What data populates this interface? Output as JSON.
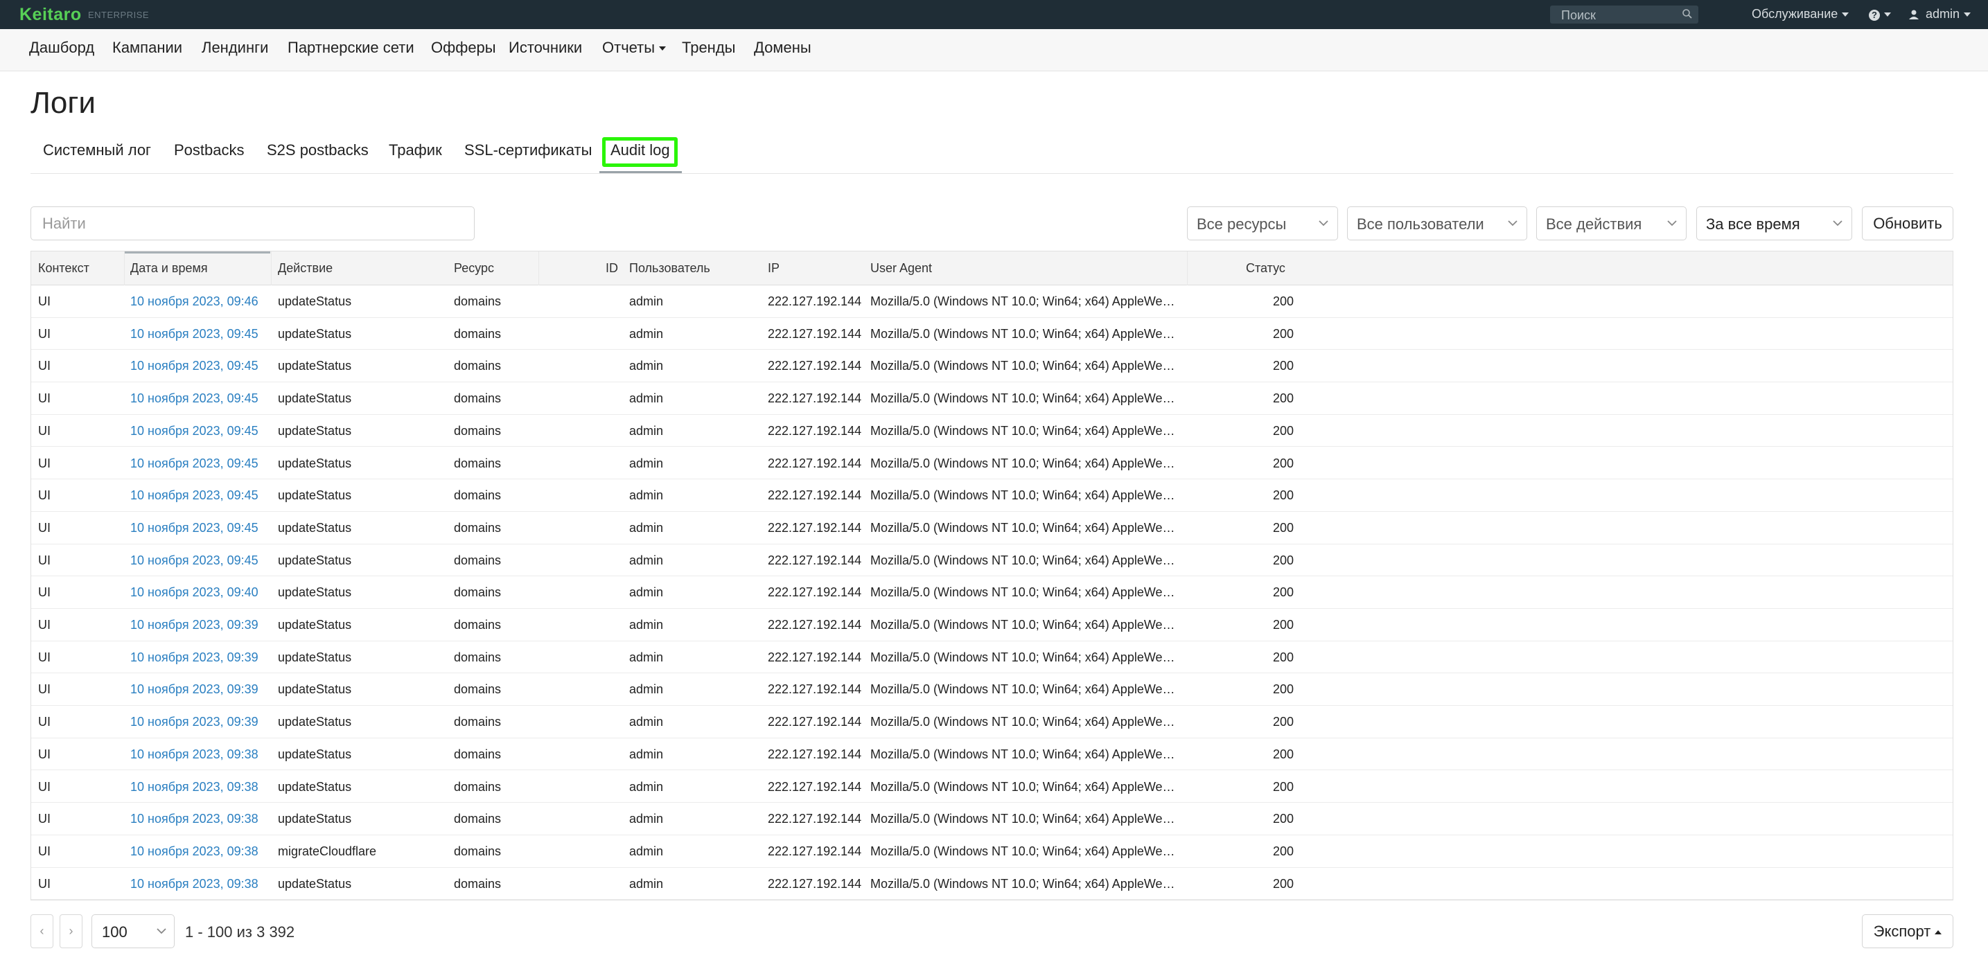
{
  "topbar": {
    "logo": "Keitaro",
    "logo_sub": "ENTERPRISE",
    "search_placeholder": "Поиск",
    "service_label": "Обслуживание",
    "help_label": "?",
    "user_label": "admin"
  },
  "nav": [
    "Дашборд",
    "Кампании",
    "Лендинги",
    "Партнерские сети",
    "Офферы",
    "Источники",
    "Отчеты",
    "Тренды",
    "Домены"
  ],
  "page_title": "Логи",
  "tabs": [
    "Системный лог",
    "Postbacks",
    "S2S postbacks",
    "Трафик",
    "SSL-сертификаты",
    "Audit log"
  ],
  "active_tab": "Audit log",
  "filters": {
    "search_placeholder": "Найти",
    "resources": "Все ресурсы",
    "users": "Все пользователи",
    "actions": "Все действия",
    "period": "За все время",
    "refresh": "Обновить"
  },
  "table": {
    "columns": [
      "Контекст",
      "Дата и время",
      "Действие",
      "Ресурс",
      "ID",
      "Пользователь",
      "IP",
      "User Agent",
      "Статус"
    ],
    "rows": [
      [
        "UI",
        "10 ноября 2023, 09:46",
        "updateStatus",
        "domains",
        "",
        "admin",
        "222.127.192.144",
        "Mozilla/5.0 (Windows NT 10.0; Win64; x64) AppleWebKit…",
        "200"
      ],
      [
        "UI",
        "10 ноября 2023, 09:45",
        "updateStatus",
        "domains",
        "",
        "admin",
        "222.127.192.144",
        "Mozilla/5.0 (Windows NT 10.0; Win64; x64) AppleWebKit…",
        "200"
      ],
      [
        "UI",
        "10 ноября 2023, 09:45",
        "updateStatus",
        "domains",
        "",
        "admin",
        "222.127.192.144",
        "Mozilla/5.0 (Windows NT 10.0; Win64; x64) AppleWebKit…",
        "200"
      ],
      [
        "UI",
        "10 ноября 2023, 09:45",
        "updateStatus",
        "domains",
        "",
        "admin",
        "222.127.192.144",
        "Mozilla/5.0 (Windows NT 10.0; Win64; x64) AppleWebKit…",
        "200"
      ],
      [
        "UI",
        "10 ноября 2023, 09:45",
        "updateStatus",
        "domains",
        "",
        "admin",
        "222.127.192.144",
        "Mozilla/5.0 (Windows NT 10.0; Win64; x64) AppleWebKit…",
        "200"
      ],
      [
        "UI",
        "10 ноября 2023, 09:45",
        "updateStatus",
        "domains",
        "",
        "admin",
        "222.127.192.144",
        "Mozilla/5.0 (Windows NT 10.0; Win64; x64) AppleWebKit…",
        "200"
      ],
      [
        "UI",
        "10 ноября 2023, 09:45",
        "updateStatus",
        "domains",
        "",
        "admin",
        "222.127.192.144",
        "Mozilla/5.0 (Windows NT 10.0; Win64; x64) AppleWebKit…",
        "200"
      ],
      [
        "UI",
        "10 ноября 2023, 09:45",
        "updateStatus",
        "domains",
        "",
        "admin",
        "222.127.192.144",
        "Mozilla/5.0 (Windows NT 10.0; Win64; x64) AppleWebKit…",
        "200"
      ],
      [
        "UI",
        "10 ноября 2023, 09:45",
        "updateStatus",
        "domains",
        "",
        "admin",
        "222.127.192.144",
        "Mozilla/5.0 (Windows NT 10.0; Win64; x64) AppleWebKit…",
        "200"
      ],
      [
        "UI",
        "10 ноября 2023, 09:40",
        "updateStatus",
        "domains",
        "",
        "admin",
        "222.127.192.144",
        "Mozilla/5.0 (Windows NT 10.0; Win64; x64) AppleWebKit…",
        "200"
      ],
      [
        "UI",
        "10 ноября 2023, 09:39",
        "updateStatus",
        "domains",
        "",
        "admin",
        "222.127.192.144",
        "Mozilla/5.0 (Windows NT 10.0; Win64; x64) AppleWebKit…",
        "200"
      ],
      [
        "UI",
        "10 ноября 2023, 09:39",
        "updateStatus",
        "domains",
        "",
        "admin",
        "222.127.192.144",
        "Mozilla/5.0 (Windows NT 10.0; Win64; x64) AppleWebKit…",
        "200"
      ],
      [
        "UI",
        "10 ноября 2023, 09:39",
        "updateStatus",
        "domains",
        "",
        "admin",
        "222.127.192.144",
        "Mozilla/5.0 (Windows NT 10.0; Win64; x64) AppleWebKit…",
        "200"
      ],
      [
        "UI",
        "10 ноября 2023, 09:39",
        "updateStatus",
        "domains",
        "",
        "admin",
        "222.127.192.144",
        "Mozilla/5.0 (Windows NT 10.0; Win64; x64) AppleWebKit…",
        "200"
      ],
      [
        "UI",
        "10 ноября 2023, 09:38",
        "updateStatus",
        "domains",
        "",
        "admin",
        "222.127.192.144",
        "Mozilla/5.0 (Windows NT 10.0; Win64; x64) AppleWebKit…",
        "200"
      ],
      [
        "UI",
        "10 ноября 2023, 09:38",
        "updateStatus",
        "domains",
        "",
        "admin",
        "222.127.192.144",
        "Mozilla/5.0 (Windows NT 10.0; Win64; x64) AppleWebKit…",
        "200"
      ],
      [
        "UI",
        "10 ноября 2023, 09:38",
        "updateStatus",
        "domains",
        "",
        "admin",
        "222.127.192.144",
        "Mozilla/5.0 (Windows NT 10.0; Win64; x64) AppleWebKit…",
        "200"
      ],
      [
        "UI",
        "10 ноября 2023, 09:38",
        "migrateCloudflare",
        "domains",
        "",
        "admin",
        "222.127.192.144",
        "Mozilla/5.0 (Windows NT 10.0; Win64; x64) AppleWebKit…",
        "200"
      ],
      [
        "UI",
        "10 ноября 2023, 09:38",
        "updateStatus",
        "domains",
        "",
        "admin",
        "222.127.192.144",
        "Mozilla/5.0 (Windows NT 10.0; Win64; x64) AppleWebKit…",
        "200"
      ]
    ]
  },
  "pagination": {
    "prev": "‹",
    "next": "›",
    "page_size": "100",
    "info": "1 - 100 из 3 392",
    "export": "Экспорт"
  },
  "colors": {
    "topbar_bg": "#1f2d36",
    "logo": "#57d056",
    "link": "#2a7fc1",
    "highlight": "#2bf508"
  },
  "icons": [
    "search-icon",
    "chevron-down-icon",
    "help-icon",
    "user-icon"
  ]
}
